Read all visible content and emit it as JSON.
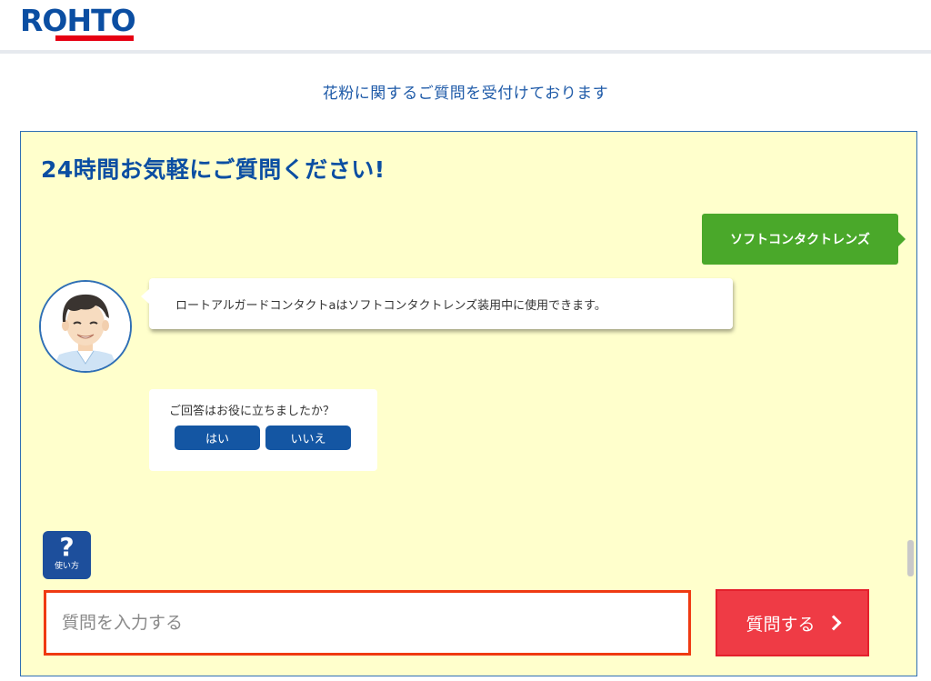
{
  "header": {
    "logo_text": "ROHTO",
    "subtitle": "花粉に関するご質問を受付けております"
  },
  "chat": {
    "title": "24時間お気軽にご質問ください!",
    "user_message": "ソフトコンタクトレンズ",
    "bot_message": "ロートアルガードコンタクトaはソフトコンタクトレンズ装用中に使用できます。",
    "feedback": {
      "question": "ご回答はお役に立ちましたか？",
      "yes_label": "はい",
      "no_label": "いいえ"
    },
    "help": {
      "icon_glyph": "?",
      "label": "使い方"
    },
    "input": {
      "placeholder": "質問を入力する",
      "value": ""
    },
    "submit_label": "質問する"
  },
  "colors": {
    "brand_blue": "#0b4ea2",
    "brand_red": "#e60012",
    "panel_bg": "#ffffcc",
    "user_bubble": "#4aa82a",
    "button_blue": "#1456a3",
    "submit_red": "#ef3b45"
  },
  "icons": [
    "help-icon",
    "chevron-right-icon",
    "avatar-icon"
  ]
}
